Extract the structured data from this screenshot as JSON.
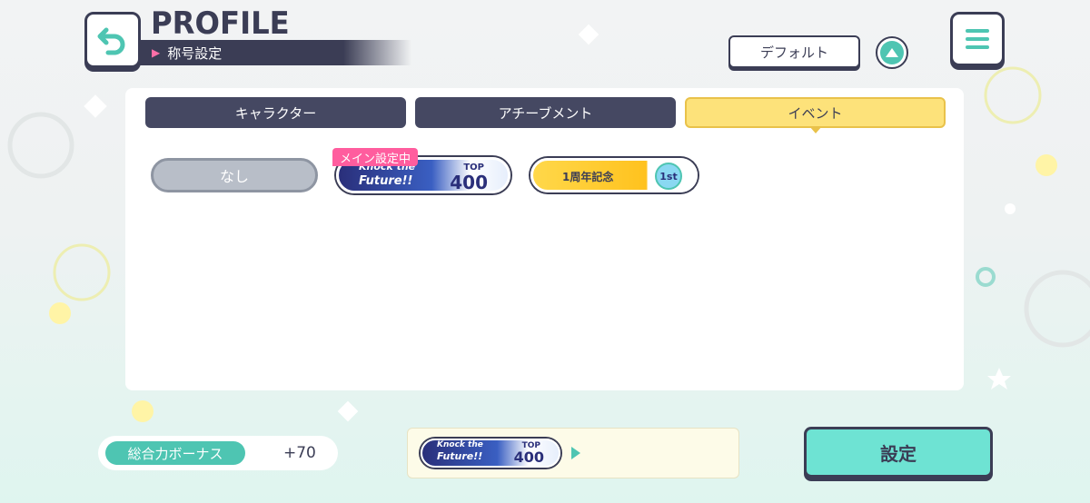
{
  "header": {
    "title": "PROFILE",
    "subtitle": "称号設定",
    "sort_label": "デフォルト"
  },
  "tabs": [
    {
      "label": "キャラクター",
      "active": false
    },
    {
      "label": "アチーブメント",
      "active": false
    },
    {
      "label": "イベント",
      "active": true
    }
  ],
  "titles": {
    "none_label": "なし",
    "main_tag": "メイン設定中",
    "knock_badge": {
      "line1": "Knock the",
      "line2": "Future!!",
      "rank_label": "TOP",
      "rank_value": "400"
    },
    "anniv_badge": {
      "label": "1周年記念",
      "icon_text": "1st"
    }
  },
  "footer": {
    "bonus_label": "総合力ボーナス",
    "bonus_value": "+70",
    "preview_badge": {
      "line1": "Knock the",
      "line2": "Future!!",
      "rank_label": "TOP",
      "rank_value": "400"
    },
    "set_label": "設定"
  },
  "colors": {
    "navy": "#3b3d55",
    "teal": "#4ec5b2",
    "active_tab": "#fde27a",
    "pink": "#ff5d9e"
  }
}
